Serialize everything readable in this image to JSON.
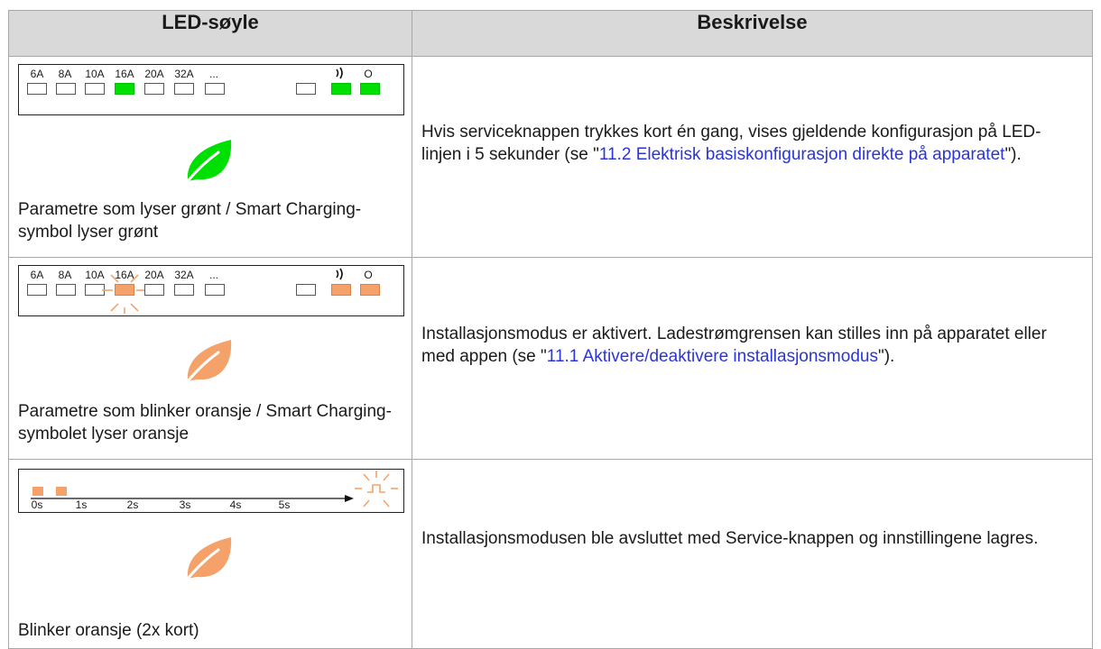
{
  "header": {
    "col1": "LED-søyle",
    "col2": "Beskrivelse"
  },
  "led_labels": [
    "6A",
    "8A",
    "10A",
    "16A",
    "20A",
    "32A",
    "...",
    "",
    "",
    "O"
  ],
  "rows": [
    {
      "caption": "Parametre som lyser grønt / Smart Charging-symbol lyser grønt",
      "desc_before": "Hvis serviceknappen trykkes kort én gang, vises gjeldende konfigurasjon på LED-linjen i 5 sekunder (se \"",
      "desc_link": "11.2 Elektrisk basiskonfigurasjon direkte på apparatet",
      "desc_after": "\").",
      "color": "#00e000"
    },
    {
      "caption": "Parametre som blinker oransje / Smart Charging-symbolet lyser oransje",
      "desc_before": "Installasjonsmodus er aktivert. Ladestrømgrensen kan stilles inn på apparatet eller med appen (se \"",
      "desc_link": "11.1 Aktivere/deaktivere installasjonsmodus",
      "desc_after": "\").",
      "color": "#f5a26a"
    },
    {
      "caption": "Blinker oransje (2x kort)",
      "desc_before": "Installasjonsmodusen ble avsluttet med Service-knappen og innstillingene lagres.",
      "desc_link": "",
      "desc_after": "",
      "color": "#f5a26a"
    }
  ],
  "timeline": {
    "ticks": [
      "0s",
      "1s",
      "2s",
      "3s",
      "4s",
      "5s"
    ]
  },
  "icons": {
    "leaf": "leaf-icon",
    "wireless": "wireless-icon",
    "blink": "blink-rays-icon"
  }
}
